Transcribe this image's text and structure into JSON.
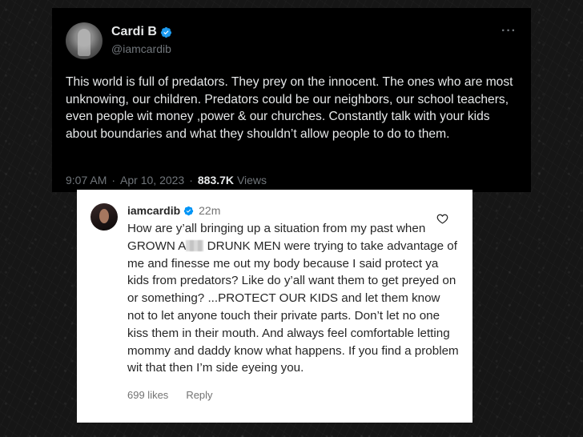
{
  "tweet": {
    "display_name": "Cardi B",
    "handle": "@iamcardib",
    "more_label": "···",
    "text": "This world is full of predators. They prey on the innocent. The ones who are most unknowing, our children. Predators could be our neighbors, our school teachers, even people wit money ,power & our churches. Constantly talk with your kids about boundaries and what they shouldn’t allow people to do to them.",
    "time": "9:07 AM",
    "date": "Apr 10, 2023",
    "separator": "·",
    "views_count": "883.7K",
    "views_label": "Views",
    "colors": {
      "background": "#000000",
      "text": "#e7e9ea",
      "muted": "#71767b",
      "verified": "#1d9bf0"
    }
  },
  "comment": {
    "username": "iamcardib",
    "time": "22m",
    "text_before_censor": "How are y’all bringing up a situation from my past when GROWN A",
    "text_after_censor": " DRUNK MEN were trying to take advantage of me and finesse me out my body because I said protect ya kids from predators? Like do y’all want them to get preyed on or something? ...PROTECT OUR KIDS and let them know not to let anyone touch their private parts. Don’t let no one kiss them in their mouth. And always feel comfortable letting mommy and daddy know what happens. If you find a problem wit that then I’m side eyeing you.",
    "likes": "699 likes",
    "reply_label": "Reply",
    "colors": {
      "background": "#ffffff",
      "text": "#262626",
      "muted": "#737373",
      "verified": "#0095f6"
    }
  },
  "icons": {
    "verified": "verified-badge-icon",
    "heart": "heart-outline-icon",
    "more": "more-horizontal-icon"
  }
}
